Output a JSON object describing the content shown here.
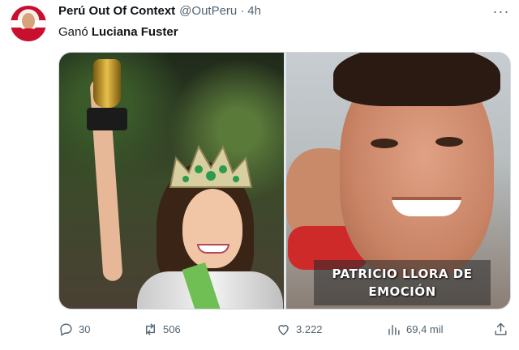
{
  "tweet": {
    "author_name": "Perú Out Of Context",
    "handle": "@OutPeru",
    "separator": "·",
    "time": "4h",
    "text_prefix": "Ganó ",
    "text_bold": "Luciana Fuster",
    "more_label": "···"
  },
  "media": {
    "right_caption_line1": "PATRICIO LLORA DE",
    "right_caption_line2": "EMOCIÓN"
  },
  "actions": {
    "replies": "30",
    "reposts": "506",
    "likes": "3.222",
    "views": "69,4 mil"
  },
  "icons": {
    "reply": "reply-icon",
    "repost": "repost-icon",
    "like": "heart-icon",
    "views": "views-icon",
    "share": "share-icon",
    "more": "more-icon"
  },
  "colors": {
    "text": "#0f1419",
    "muted": "#536471",
    "border": "#cfd9de"
  }
}
